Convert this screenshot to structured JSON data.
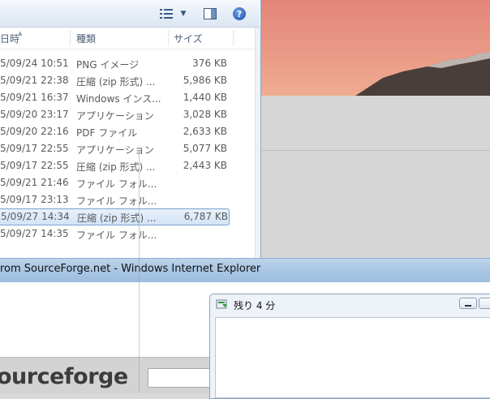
{
  "explorer": {
    "columns": [
      {
        "label": "日時"
      },
      {
        "label": "種類"
      },
      {
        "label": "サイズ"
      }
    ],
    "rows": [
      {
        "date": "5/09/24 10:51",
        "type": "PNG イメージ",
        "size": "376 KB"
      },
      {
        "date": "5/09/21 22:38",
        "type": "圧縮 (zip 形式) ...",
        "size": "5,986 KB"
      },
      {
        "date": "5/09/21 16:37",
        "type": "Windows インス...",
        "size": "1,440 KB"
      },
      {
        "date": "5/09/20 23:17",
        "type": "アプリケーション",
        "size": "3,028 KB"
      },
      {
        "date": "5/09/20 22:16",
        "type": "PDF ファイル",
        "size": "2,633 KB"
      },
      {
        "date": "5/09/17 22:55",
        "type": "アプリケーション",
        "size": "5,077 KB"
      },
      {
        "date": "5/09/17 22:55",
        "type": "圧縮 (zip 形式) ...",
        "size": "2,443 KB"
      },
      {
        "date": "5/09/21 21:46",
        "type": "ファイル フォル...",
        "size": ""
      },
      {
        "date": "5/09/17 23:13",
        "type": "ファイル フォル...",
        "size": ""
      },
      {
        "date": "5/09/27 14:34",
        "type": "圧縮 (zip 形式) ...",
        "size": "6,787 KB",
        "selected": true
      },
      {
        "date": "5/09/27 14:35",
        "type": "ファイル フォル...",
        "size": ""
      }
    ]
  },
  "ie": {
    "title": "rom SourceForge.net - Windows Internet Explorer",
    "logo": "ourceforge"
  },
  "download": {
    "title": "残り 4 分"
  },
  "colors": {
    "selection": "#d2e4f7",
    "titlebar": "#a9c6e4",
    "wallpaper": "#ea9a86"
  }
}
